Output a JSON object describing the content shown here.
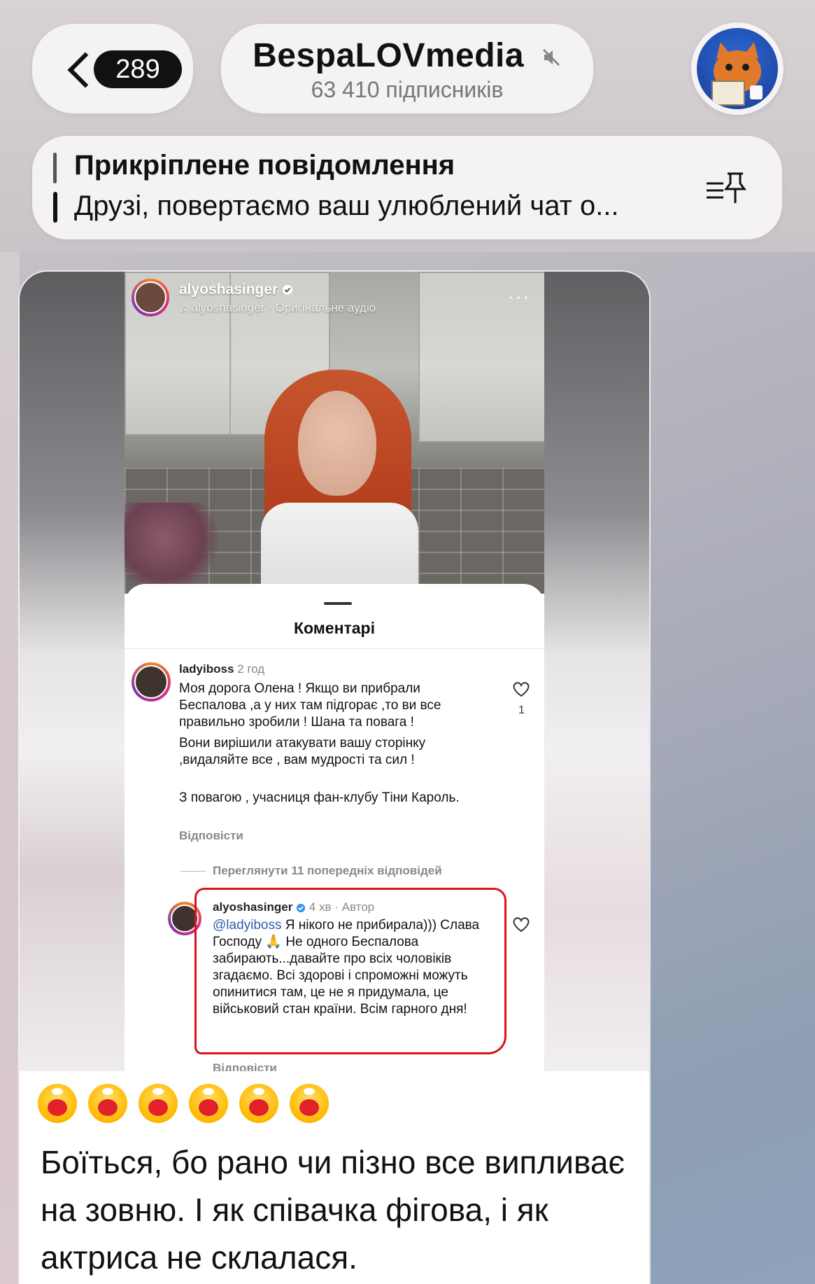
{
  "header": {
    "back_count": "289",
    "channel_title": "BespaLOVmedia",
    "subscribers": "63 410 підписників"
  },
  "pinned": {
    "title": "Прикріплене повідомлення",
    "text": "Друзі, повертаємо ваш улюблений чат о..."
  },
  "post": {
    "instagram": {
      "username": "alyoshasinger",
      "audio": "alyoshasinger · Оригінальне аудіо",
      "sheet_title": "Коментарі",
      "comment1": {
        "username": "ladyiboss",
        "time": "2 год",
        "p1": "Моя дорога Олена ! Якщо ви прибрали Беспалова ,а у них там підгорає ,то ви все правильно зробили ! Шана та повага !",
        "p2": "Вони вирішили атакувати вашу сторінку ,видаляйте все , вам мудрості та сил !",
        "p3": "З повагою , учасниця фан-клубу Тіни Кароль.",
        "reply": "Відповісти",
        "likes": "1"
      },
      "view_replies": "Переглянути 11 попередніх відповідей",
      "comment2": {
        "username": "alyoshasinger",
        "meta": "4 хв · Автор",
        "mention": "@ladyiboss",
        "text": "Я нікого не прибирала))) Слава Господу 🙏 Не одного Беспалова забирають...давайте про всіх чоловіків згадаємо. Всі здорові і спроможні можуть опинитися там, це не я придумала, це військовий стан країни. Всім гарного дня!",
        "reply": "Відповісти"
      }
    },
    "emoji": [
      "clown-face",
      "clown-face",
      "clown-face",
      "clown-face",
      "clown-face",
      "clown-face"
    ],
    "text": "Боїться, бо рано чи пізно все випливає на зовню. І як співачка фігова, і як актриса не склалася."
  },
  "colors": {
    "highlight_outline": "#d8141c",
    "mention": "#2f5fa8"
  }
}
